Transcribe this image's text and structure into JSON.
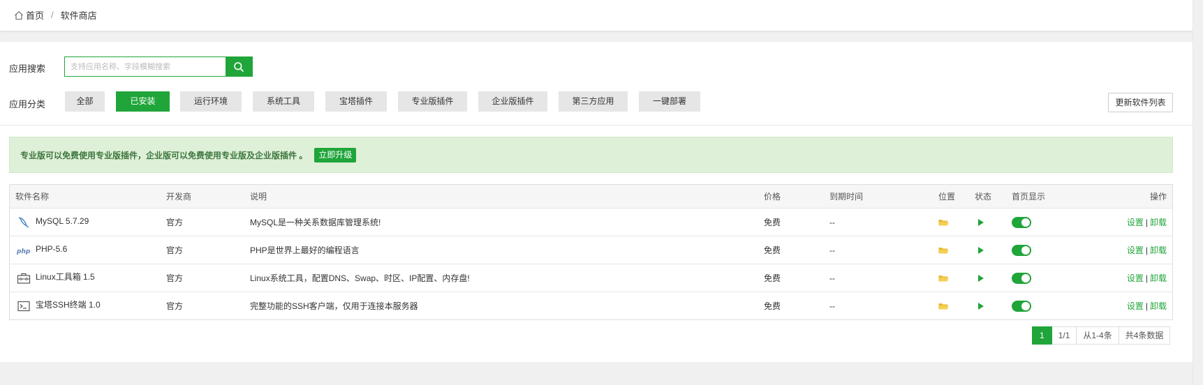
{
  "breadcrumb": {
    "home": "首页",
    "separator": "/",
    "current": "软件商店"
  },
  "search": {
    "label": "应用搜索",
    "placeholder": "支持应用名称、字段模糊搜索",
    "value": ""
  },
  "category": {
    "label": "应用分类",
    "items": [
      "全部",
      "已安装",
      "运行环境",
      "系统工具",
      "宝塔插件",
      "专业版插件",
      "企业版插件",
      "第三方应用",
      "一键部署"
    ],
    "active_index": 1
  },
  "refresh_label": "更新软件列表",
  "notice": {
    "text": "专业版可以免费使用专业版插件，企业版可以免费使用专业版及企业版插件 。",
    "button": "立即升级"
  },
  "table": {
    "headers": {
      "name": "软件名称",
      "developer": "开发商",
      "description": "说明",
      "price": "价格",
      "expire": "到期时间",
      "location": "位置",
      "status": "状态",
      "homepage": "首页显示",
      "actions": "操作"
    },
    "rows": [
      {
        "icon": "mysql-dolphin-icon",
        "name": "MySQL 5.7.29",
        "developer": "官方",
        "description": "MySQL是一种关系数据库管理系统!",
        "price": "免费",
        "expire": "--",
        "homepage_on": true,
        "settings": "设置",
        "separator": "|",
        "uninstall": "卸载"
      },
      {
        "icon": "php-icon",
        "name": "PHP-5.6",
        "developer": "官方",
        "description": "PHP是世界上最好的编程语言",
        "price": "免费",
        "expire": "--",
        "homepage_on": true,
        "settings": "设置",
        "separator": "|",
        "uninstall": "卸载"
      },
      {
        "icon": "toolbox-icon",
        "name": "Linux工具箱 1.5",
        "developer": "官方",
        "description": "Linux系统工具，配置DNS、Swap、时区、IP配置、内存盘!",
        "price": "免费",
        "expire": "--",
        "homepage_on": true,
        "settings": "设置",
        "separator": "|",
        "uninstall": "卸载"
      },
      {
        "icon": "terminal-icon",
        "name": "宝塔SSH终端 1.0",
        "developer": "官方",
        "description": "完整功能的SSH客户端，仅用于连接本服务器",
        "price": "免费",
        "expire": "--",
        "homepage_on": true,
        "settings": "设置",
        "separator": "|",
        "uninstall": "卸载"
      }
    ]
  },
  "pagination": {
    "current": "1",
    "pages": "1/1",
    "range": "从1-4条",
    "total": "共4条数据"
  },
  "colors": {
    "accent": "#20a53a",
    "folder": "#f0c040",
    "notice_bg": "#dff0d8",
    "notice_text": "#3c763d"
  }
}
